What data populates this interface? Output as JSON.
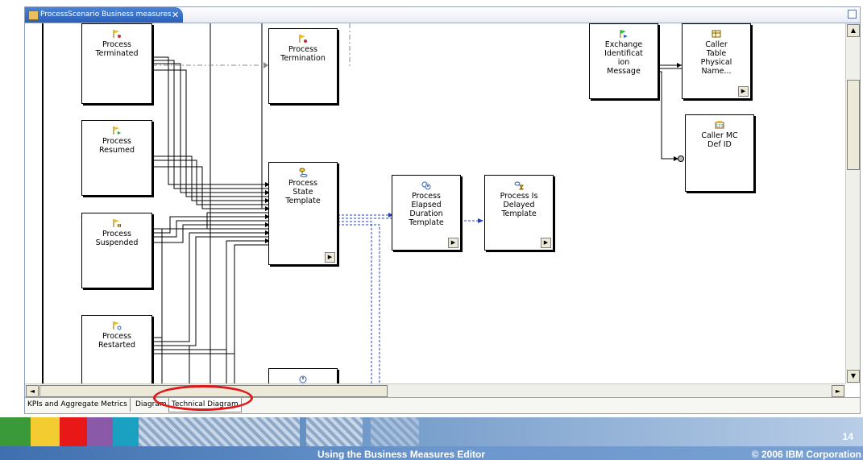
{
  "editor": {
    "tab_title": "ProcessScenario Business measures",
    "tab_close": "✕"
  },
  "nodes": {
    "process_terminated": "Process\nTerminated",
    "process_termination": "Process\nTermination",
    "process_resumed": "Process\nResumed",
    "process_suspended": "Process\nSuspended",
    "process_restarted": "Process\nRestarted",
    "process_state_template": "Process\nState\nTemplate",
    "process_elapsed_duration_template": "Process\nElapsed\nDuration\nTemplate",
    "process_is_delayed_template": "Process Is\nDelayed\nTemplate",
    "exchange_identification_message": "Exchange\nIdentificat\nion\nMessage",
    "caller_table_physical_name": "Caller\nTable\nPhysical\nName...",
    "caller_mc_def_id": "Caller MC\nDef ID"
  },
  "bottom_tabs": {
    "kpis": "KPIs and Aggregate Metrics",
    "diagram": "Diagram",
    "technical": "Technical Diagram"
  },
  "scrollbar": {
    "up": "▲",
    "down": "▼",
    "left": "◄",
    "right": "►"
  },
  "footer": {
    "slide_number": "14",
    "title": "Using the Business Measures Editor",
    "copyright": "© 2006 IBM Corporation"
  },
  "colors": {
    "highlight": "#e01818",
    "tab_active": "#2c5fb8",
    "footer_blue": "#2a5c9a"
  }
}
